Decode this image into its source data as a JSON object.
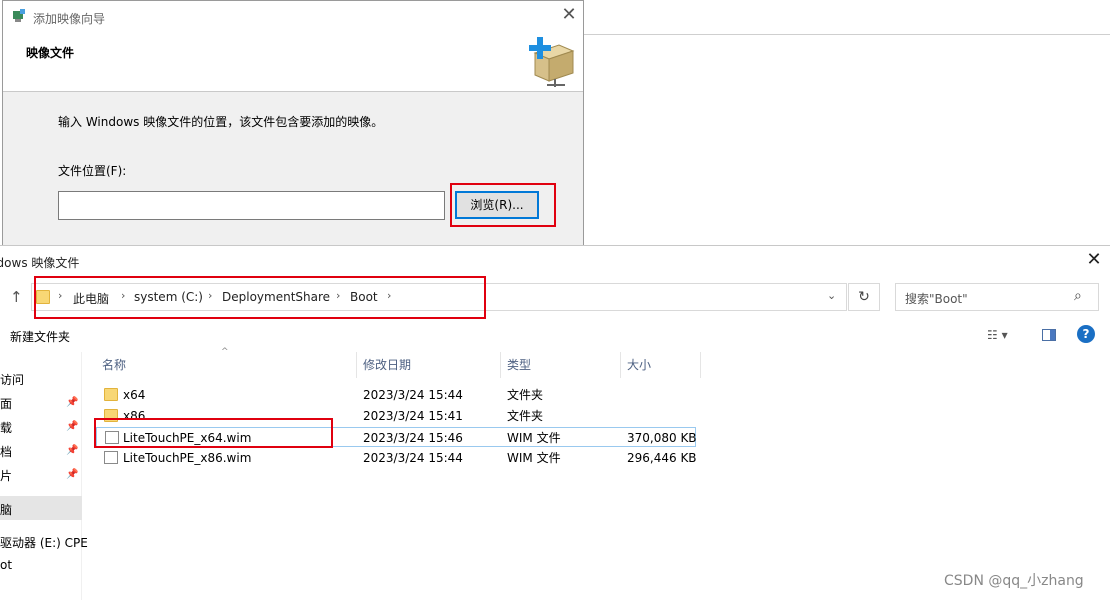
{
  "wizard": {
    "title": "添加映像向导",
    "heading": "映像文件",
    "description": "输入 Windows 映像文件的位置，该文件包含要添加的映像。",
    "file_location_label": "文件位置(F):",
    "file_location_value": "",
    "browse_label": "浏览(R)...",
    "close": "✕"
  },
  "open_dialog": {
    "title": "Windows 映像文件",
    "close": "✕",
    "breadcrumb": [
      "此电脑",
      "system (C:)",
      "DeploymentShare",
      "Boot"
    ],
    "search_placeholder": "搜索\"Boot\"",
    "new_folder": "新建文件夹",
    "columns": [
      "名称",
      "修改日期",
      "类型",
      "大小"
    ],
    "files": [
      {
        "name": "x64",
        "date": "2023/3/24 15:44",
        "type": "文件夹",
        "size": "",
        "icon": "folder-icon"
      },
      {
        "name": "x86",
        "date": "2023/3/24 15:41",
        "type": "文件夹",
        "size": "",
        "icon": "folder-icon"
      },
      {
        "name": "LiteTouchPE_x64.wim",
        "date": "2023/3/24 15:46",
        "type": "WIM 文件",
        "size": "370,080 KB",
        "icon": "file-icon"
      },
      {
        "name": "LiteTouchPE_x86.wim",
        "date": "2023/3/24 15:44",
        "type": "WIM 文件",
        "size": "296,446 KB",
        "icon": "file-icon"
      }
    ],
    "sidebar": [
      "访问",
      "面",
      "载",
      "档",
      "片",
      "脑",
      "驱动器 (E:) CPE",
      "ot"
    ]
  },
  "watermark": "CSDN @qq_小zhang",
  "colors": {
    "highlight_box": "#e0000f",
    "accent": "#0078d7"
  }
}
